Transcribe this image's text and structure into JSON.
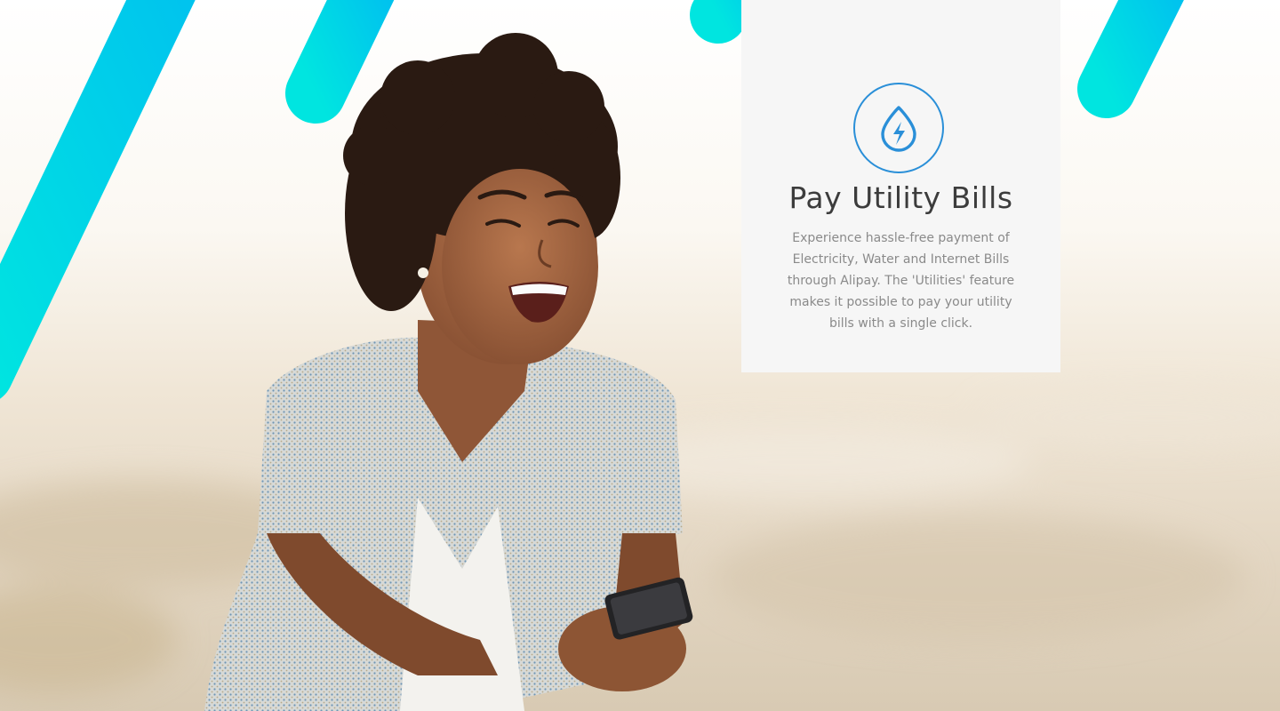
{
  "feature": {
    "icon": "utility-drop-bolt-icon",
    "title": "Pay Utility Bills",
    "description": "Experience hassle-free payment of Electricity, Water and Internet Bills through Alipay. The 'Utilities' feature makes it possible to pay your utility bills with a single click."
  },
  "colors": {
    "accent_stripe_start": "#00e5e0",
    "accent_stripe_end": "#00c3ee",
    "icon_ring": "#2a8fd8",
    "card_background": "#f6f6f6",
    "title_text": "#3c3c3c",
    "body_text": "#8a8a8a"
  }
}
